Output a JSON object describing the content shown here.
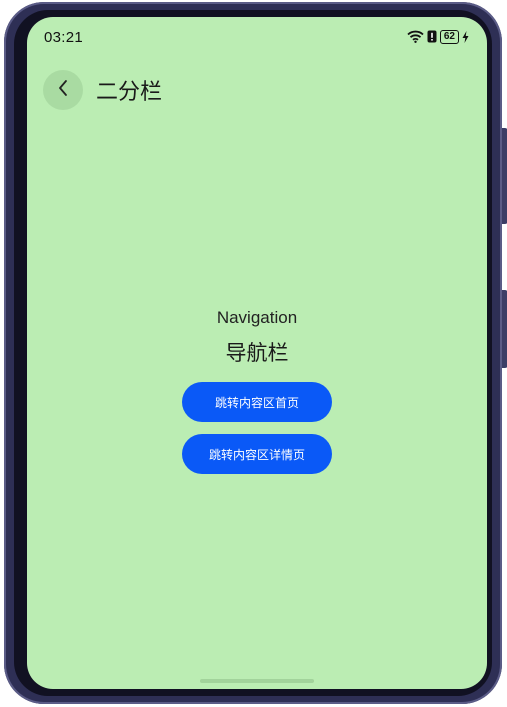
{
  "status_bar": {
    "time": "03:21",
    "battery_level": "62",
    "icons": [
      "wifi-icon",
      "alert-icon",
      "battery-icon",
      "charging-icon"
    ]
  },
  "header": {
    "back_icon": "chevron-left-icon",
    "title": "二分栏"
  },
  "navigation": {
    "label": "Navigation",
    "title": "导航栏",
    "buttons": [
      {
        "label": "跳转内容区首页"
      },
      {
        "label": "跳转内容区详情页"
      }
    ]
  },
  "colors": {
    "screen_background": "#bbedb3",
    "button_primary": "#0a59f7",
    "back_button_bg": "#a9dba2",
    "device_frame": "#2e2f55"
  }
}
